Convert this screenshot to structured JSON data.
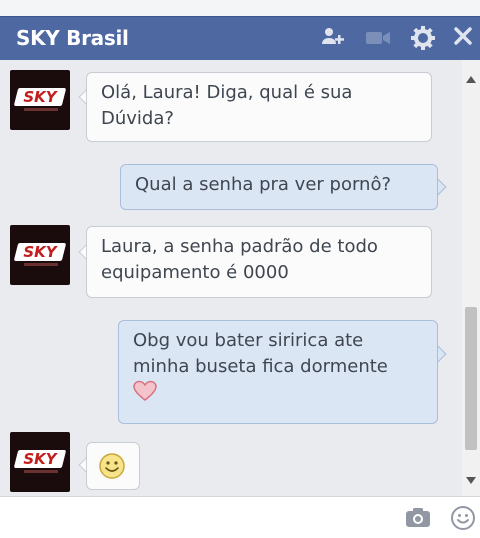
{
  "window": {
    "title": "SKY Brasil",
    "icons": [
      "add-friend-icon",
      "video-call-icon",
      "gear-icon",
      "close-icon"
    ]
  },
  "contact": {
    "avatar_text": "SKY"
  },
  "messages": [
    {
      "from": "SKY Brasil",
      "direction": "incoming",
      "text": "Olá, Laura! Diga, qual é sua Dúvida?"
    },
    {
      "from": "Laura",
      "direction": "outgoing",
      "text": "Qual a senha pra ver pornô?"
    },
    {
      "from": "SKY Brasil",
      "direction": "incoming",
      "text": "Laura, a senha padrão de todo equipamento é 0000"
    },
    {
      "from": "Laura",
      "direction": "outgoing",
      "text": "Obg vou bater siririca ate minha buseta fica dormente",
      "emoji": "heart-icon"
    },
    {
      "from": "SKY Brasil",
      "direction": "incoming",
      "text": "",
      "emoji": "smiley-icon"
    }
  ],
  "composer": {
    "placeholder": "",
    "icons": [
      "camera-icon",
      "emoji-icon"
    ]
  }
}
